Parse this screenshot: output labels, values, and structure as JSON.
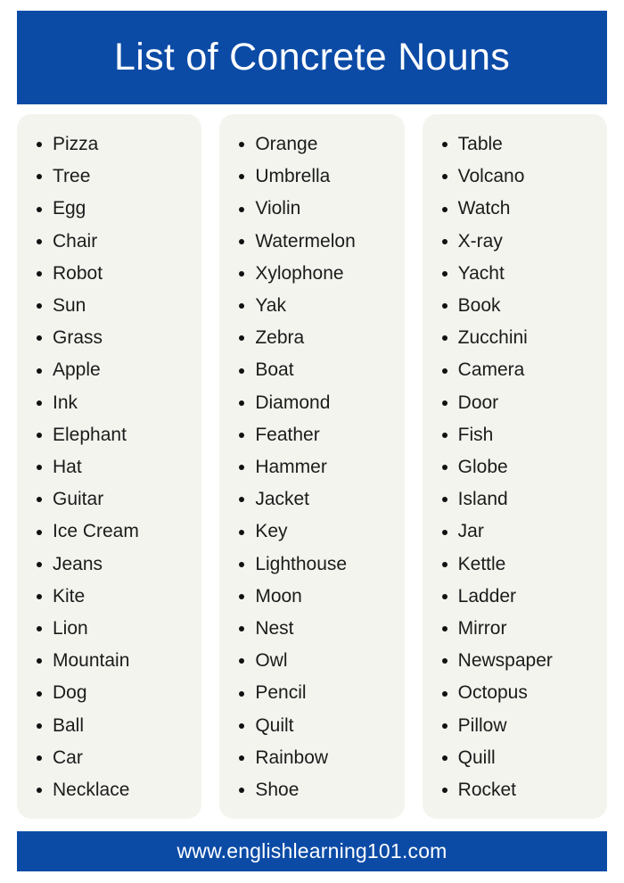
{
  "header": {
    "title": "List of Concrete Nouns",
    "background_color": "#0b4ba6",
    "text_color": "#ffffff"
  },
  "footer": {
    "url": "www.englishlearning101.com",
    "background_color": "#0b4ba6",
    "text_color": "#ffffff"
  },
  "page": {
    "background_color": "#ffffff",
    "card_background_color": "#f4f4ef",
    "text_color": "#1b1b1b",
    "bullet_color": "#111111"
  },
  "columns": [
    {
      "id": "column-1",
      "items": [
        "Pizza",
        "Tree",
        "Egg",
        "Chair",
        "Robot",
        "Sun",
        "Grass",
        "Apple",
        "Ink",
        "Elephant",
        "Hat",
        "Guitar",
        "Ice Cream",
        "Jeans",
        "Kite",
        "Lion",
        "Mountain",
        "Dog",
        "Ball",
        "Car",
        "Necklace"
      ]
    },
    {
      "id": "column-2",
      "items": [
        "Orange",
        "Umbrella",
        "Violin",
        "Watermelon",
        "Xylophone",
        "Yak",
        "Zebra",
        "Boat",
        "Diamond",
        "Feather",
        "Hammer",
        "Jacket",
        "Key",
        "Lighthouse",
        "Moon",
        "Nest",
        "Owl",
        "Pencil",
        "Quilt",
        "Rainbow",
        "Shoe"
      ]
    },
    {
      "id": "column-3",
      "items": [
        "Table",
        "Volcano",
        "Watch",
        "X-ray",
        "Yacht",
        "Book",
        "Zucchini",
        "Camera",
        "Door",
        "Fish",
        "Globe",
        "Island",
        "Jar",
        "Kettle",
        "Ladder",
        "Mirror",
        "Newspaper",
        "Octopus",
        "Pillow",
        "Quill",
        "Rocket"
      ]
    }
  ]
}
